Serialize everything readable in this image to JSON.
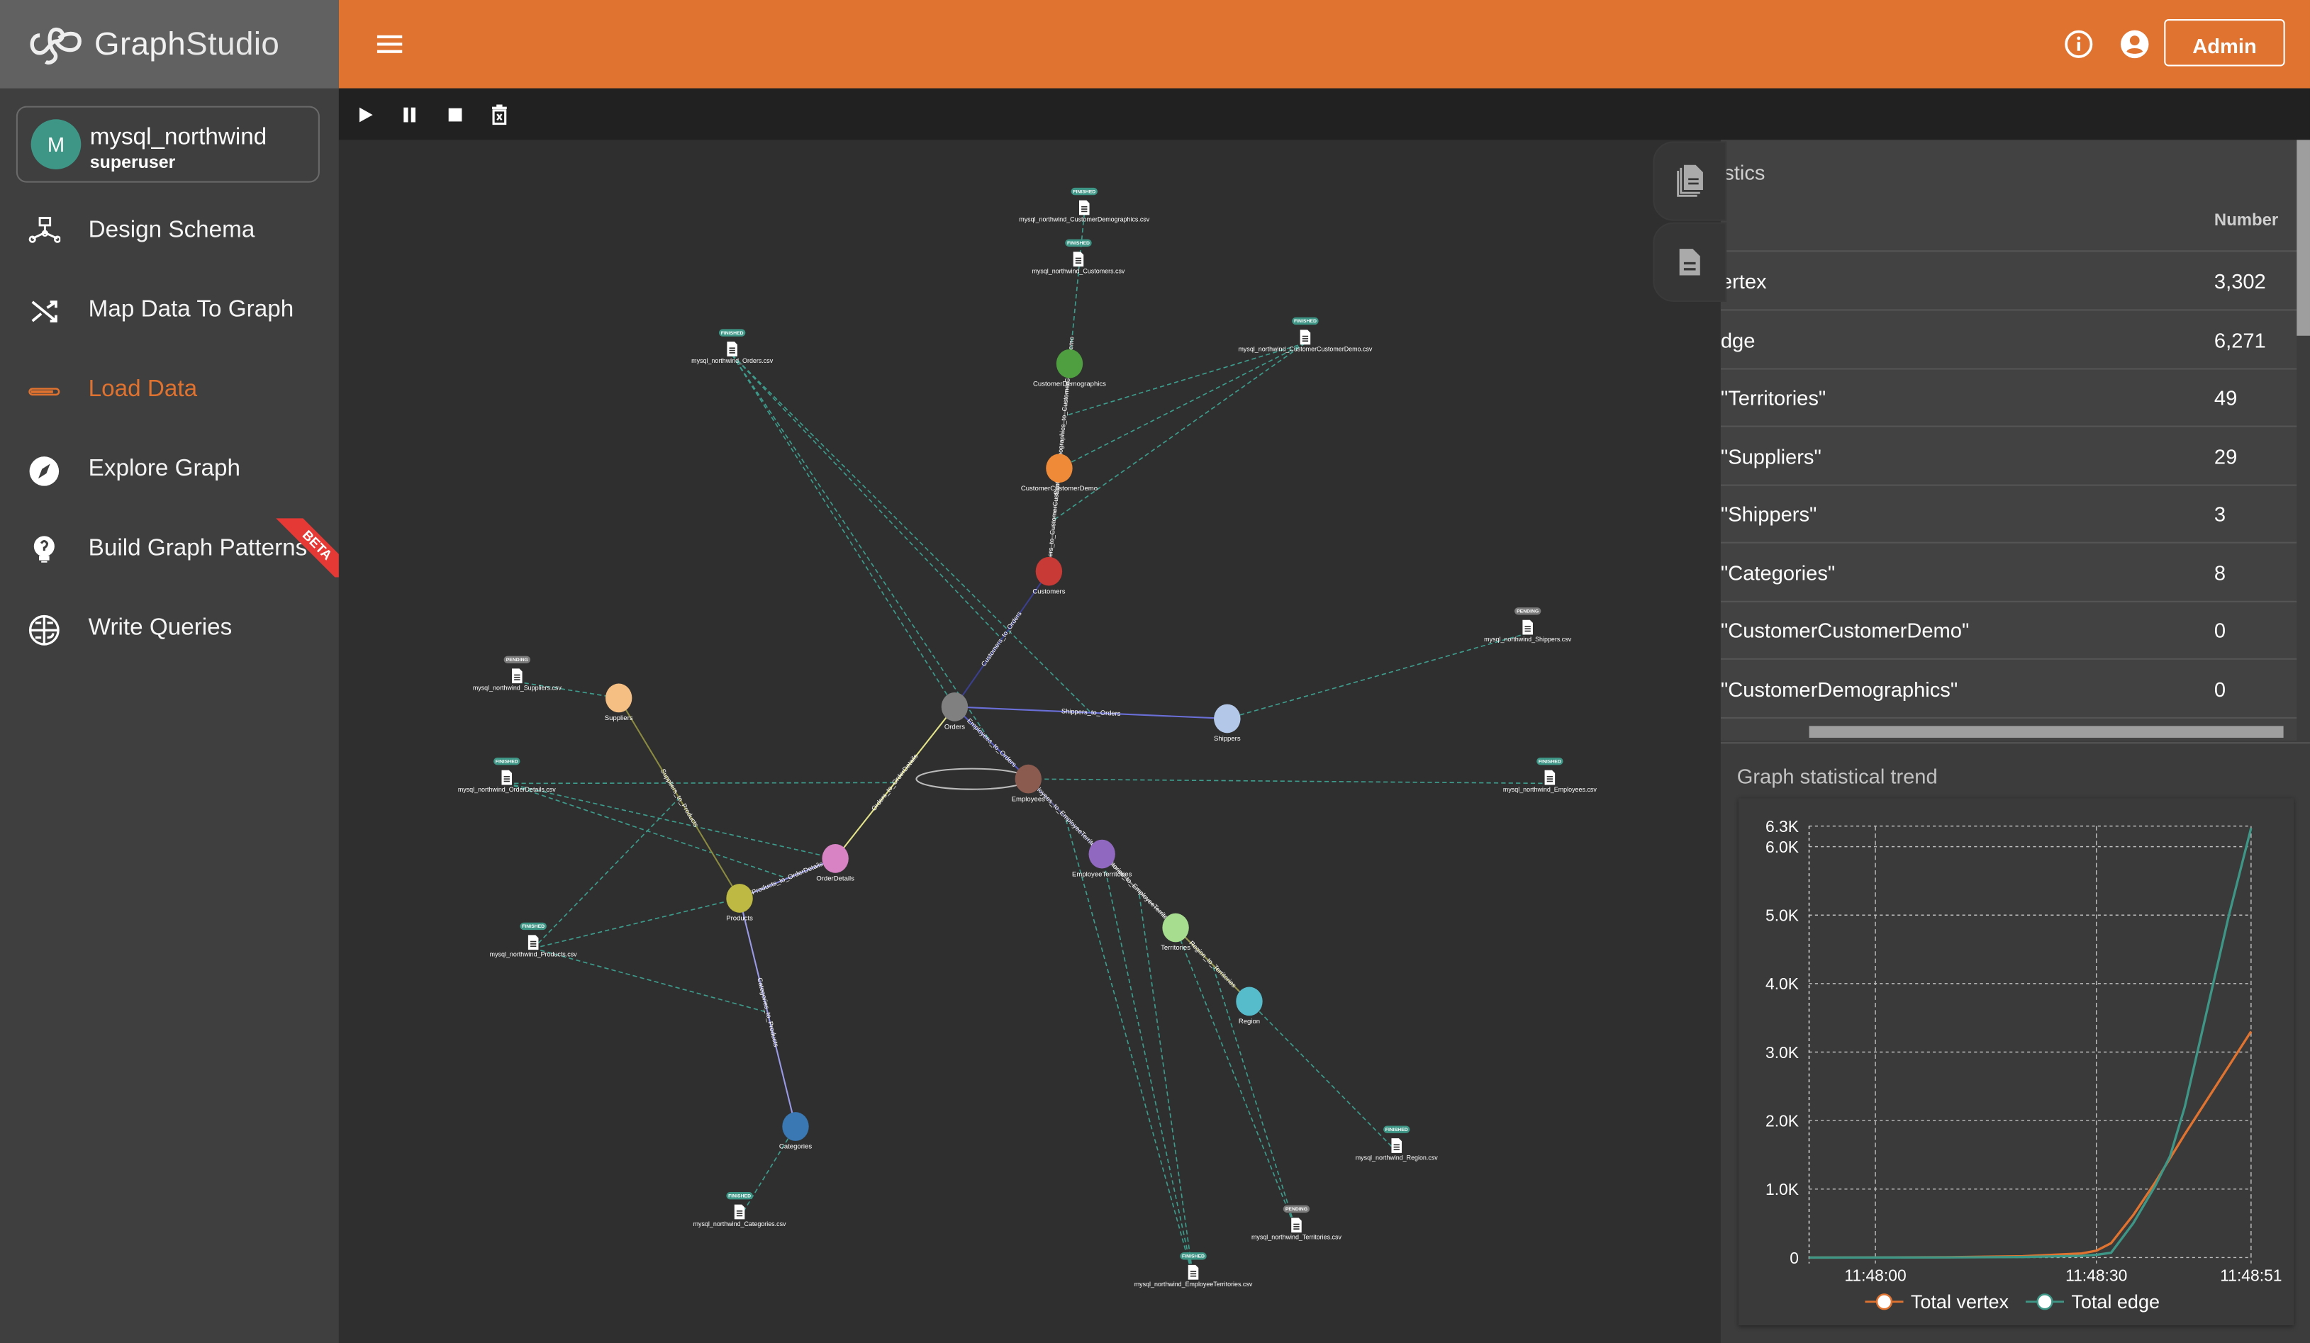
{
  "app": {
    "logo_text_bold": "Graph",
    "logo_text_light": "Studio"
  },
  "graph_card": {
    "avatar_letter": "M",
    "name": "mysql_northwind",
    "role": "superuser"
  },
  "sidebar": {
    "items": [
      {
        "label": "Design Schema",
        "icon": "schema-icon",
        "active": false
      },
      {
        "label": "Map Data To Graph",
        "icon": "shuffle-icon",
        "active": false
      },
      {
        "label": "Load Data",
        "icon": "progress-bar-icon",
        "active": true
      },
      {
        "label": "Explore Graph",
        "icon": "compass-icon",
        "active": false
      },
      {
        "label": "Build Graph Patterns",
        "icon": "lightbulb-icon",
        "active": false,
        "badge": "BETA"
      },
      {
        "label": "Write Queries",
        "icon": "query-globe-icon",
        "active": false
      }
    ]
  },
  "topbar": {
    "admin_label": "Admin",
    "menu_icon": "hamburger-icon",
    "info_icon": "info-icon",
    "user_icon": "account-circle-icon"
  },
  "toolbar": {
    "buttons": [
      "play-icon",
      "pause-icon",
      "stop-icon",
      "delete-icon"
    ]
  },
  "colors": {
    "accent": "#e07330",
    "finished": "#3d9686",
    "pending": "#7a7a7a",
    "mapping_line": "#3d9c8c",
    "vertex_series": "#e07330",
    "edge_series": "#3d9686"
  },
  "graph": {
    "vertices": [
      {
        "id": "CustomerDemographics",
        "color": "#4f9e3f"
      },
      {
        "id": "CustomerCustomerDemo",
        "color": "#ef8a38"
      },
      {
        "id": "Customers",
        "color": "#c73a35"
      },
      {
        "id": "Orders",
        "color": "#808080"
      },
      {
        "id": "Shippers",
        "color": "#b3c8e8"
      },
      {
        "id": "Employees",
        "color": "#8a5b4e"
      },
      {
        "id": "EmployeeTerritories",
        "color": "#9068c0"
      },
      {
        "id": "Territories",
        "color": "#a6dd8f"
      },
      {
        "id": "Region",
        "color": "#56bccc"
      },
      {
        "id": "Suppliers",
        "color": "#f5bf84"
      },
      {
        "id": "OrderDetails",
        "color": "#d783c4"
      },
      {
        "id": "Products",
        "color": "#bdb943"
      },
      {
        "id": "Categories",
        "color": "#3a78b3"
      }
    ],
    "edges": [
      {
        "label": "CustomerDemographics_to_CustomerCustomerDemo",
        "from": "CustomerDemographics",
        "to": "CustomerCustomerDemo",
        "color": "#6e6e6e"
      },
      {
        "label": "Customers_to_CustomerCustomerDemo",
        "from": "Customers",
        "to": "CustomerCustomerDemo",
        "color": "#6e6e6e"
      },
      {
        "label": "Customers_to_Orders",
        "from": "Customers",
        "to": "Orders",
        "color": "#3b3f8f"
      },
      {
        "label": "Shippers_to_Orders",
        "from": "Orders",
        "to": "Shippers",
        "color": "#6a6fd8"
      },
      {
        "label": "Employees_to_Orders",
        "from": "Orders",
        "to": "Employees",
        "color": "#5558c0"
      },
      {
        "label": "Orders_to_OrderDetails",
        "from": "OrderDetails",
        "to": "Orders",
        "color": "#e4e48a"
      },
      {
        "label": "Products_to_OrderDetails",
        "from": "Products",
        "to": "OrderDetails",
        "color": "#8c8cdc"
      },
      {
        "label": "Suppliers_to_Products",
        "from": "Suppliers",
        "to": "Products",
        "color": "#8a8a40"
      },
      {
        "label": "Categories_to_Products",
        "from": "Products",
        "to": "Categories",
        "color": "#9a9ae8"
      },
      {
        "label": "Employees_to_EmployeeTerritories",
        "from": "Employees",
        "to": "EmployeeTerritories",
        "color": "#5a5a8a"
      },
      {
        "label": "Territories_to_EmployeeTerritories",
        "from": "EmployeeTerritories",
        "to": "Territories",
        "color": "#888888"
      },
      {
        "label": "Region_to_Territories",
        "from": "Territories",
        "to": "Region",
        "color": "#9a9a55"
      }
    ],
    "self_loops": [
      "Employees"
    ],
    "files": [
      {
        "name": "mysql_northwind_CustomerDemographics.csv",
        "status": "FINISHED"
      },
      {
        "name": "mysql_northwind_Customers.csv",
        "status": "FINISHED"
      },
      {
        "name": "mysql_northwind_Orders.csv",
        "status": "FINISHED"
      },
      {
        "name": "mysql_northwind_CustomerCustomerDemo.csv",
        "status": "FINISHED"
      },
      {
        "name": "mysql_northwind_Shippers.csv",
        "status": "PENDING"
      },
      {
        "name": "mysql_northwind_Suppliers.csv",
        "status": "PENDING"
      },
      {
        "name": "mysql_northwind_OrderDetails.csv",
        "status": "FINISHED"
      },
      {
        "name": "mysql_northwind_Employees.csv",
        "status": "FINISHED"
      },
      {
        "name": "mysql_northwind_Products.csv",
        "status": "FINISHED"
      },
      {
        "name": "mysql_northwind_Region.csv",
        "status": "FINISHED"
      },
      {
        "name": "mysql_northwind_Territories.csv",
        "status": "PENDING"
      },
      {
        "name": "mysql_northwind_Categories.csv",
        "status": "FINISHED"
      },
      {
        "name": "mysql_northwind_EmployeeTerritories.csv",
        "status": "FINISHED"
      }
    ],
    "mappings": [
      {
        "file": "mysql_northwind_CustomerDemographics.csv",
        "target": "CustomerDemographics"
      },
      {
        "file": "mysql_northwind_CustomerCustomerDemo.csv",
        "target": "CustomerDemographics_to_CustomerCustomerDemo"
      },
      {
        "file": "mysql_northwind_CustomerCustomerDemo.csv",
        "target": "CustomerCustomerDemo"
      },
      {
        "file": "mysql_northwind_CustomerCustomerDemo.csv",
        "target": "Customers_to_CustomerCustomerDemo"
      },
      {
        "file": "mysql_northwind_Orders.csv",
        "target": "Orders"
      },
      {
        "file": "mysql_northwind_Orders.csv",
        "target": "Employees_to_Orders"
      },
      {
        "file": "mysql_northwind_Orders.csv",
        "target": "Customers_to_Orders"
      },
      {
        "file": "mysql_northwind_Orders.csv",
        "target": "Shippers_to_Orders"
      },
      {
        "file": "mysql_northwind_Shippers.csv",
        "target": "Shippers"
      },
      {
        "file": "mysql_northwind_Suppliers.csv",
        "target": "Suppliers"
      },
      {
        "file": "mysql_northwind_OrderDetails.csv",
        "target": "OrderDetails"
      },
      {
        "file": "mysql_northwind_OrderDetails.csv",
        "target": "Products_to_OrderDetails"
      },
      {
        "file": "mysql_northwind_OrderDetails.csv",
        "target": "Orders_to_OrderDetails"
      },
      {
        "file": "mysql_northwind_Employees.csv",
        "target": "Employees"
      },
      {
        "file": "mysql_northwind_Products.csv",
        "target": "Products"
      },
      {
        "file": "mysql_northwind_Products.csv",
        "target": "Suppliers_to_Products"
      },
      {
        "file": "mysql_northwind_Products.csv",
        "target": "Categories_to_Products"
      },
      {
        "file": "mysql_northwind_Categories.csv",
        "target": "Categories"
      },
      {
        "file": "mysql_northwind_Region.csv",
        "target": "Region"
      },
      {
        "file": "mysql_northwind_Territories.csv",
        "target": "Territories"
      },
      {
        "file": "mysql_northwind_Territories.csv",
        "target": "Region_to_Territories"
      },
      {
        "file": "mysql_northwind_EmployeeTerritories.csv",
        "target": "EmployeeTerritories"
      },
      {
        "file": "mysql_northwind_EmployeeTerritories.csv",
        "target": "Employees_to_EmployeeTerritories"
      },
      {
        "file": "mysql_northwind_EmployeeTerritories.csv",
        "target": "Territories_to_EmployeeTerritories"
      }
    ]
  },
  "statistics": {
    "title_visible": "istics",
    "column_number": "Number",
    "rows": [
      {
        "key": "ertex",
        "value": "3,302"
      },
      {
        "key": "dge",
        "value": "6,271"
      },
      {
        "key": "\"Territories\"",
        "value": "49"
      },
      {
        "key": "\"Suppliers\"",
        "value": "29"
      },
      {
        "key": "\"Shippers\"",
        "value": "3"
      },
      {
        "key": "\"Categories\"",
        "value": "8"
      },
      {
        "key": "\"CustomerCustomerDemo\"",
        "value": "0"
      },
      {
        "key": "\"CustomerDemographics\"",
        "value": "0"
      }
    ],
    "tab_icons": [
      "file-copy-icon",
      "description-icon"
    ]
  },
  "trend_title": "Graph statistical trend",
  "chart_data": {
    "type": "line",
    "title": "",
    "xlabel": "",
    "ylabel": "",
    "x_ticks": [
      "11:48:00",
      "11:48:30",
      "11:48:51"
    ],
    "y_ticks": [
      "0",
      "1.0K",
      "2.0K",
      "3.0K",
      "4.0K",
      "5.0K",
      "6.0K",
      "6.3K"
    ],
    "y_tick_values": [
      0,
      1000,
      2000,
      3000,
      4000,
      5000,
      6000,
      6300
    ],
    "xlim": [
      "11:47:51",
      "11:48:51"
    ],
    "ylim": [
      0,
      6300
    ],
    "grid": true,
    "legend": "bottom",
    "x": [
      "11:47:51",
      "11:48:10",
      "11:48:20",
      "11:48:28",
      "11:48:30",
      "11:48:32",
      "11:48:35",
      "11:48:38",
      "11:48:40",
      "11:48:42",
      "11:48:45",
      "11:48:48",
      "11:48:51"
    ],
    "series": [
      {
        "name": "Total vertex",
        "color": "#e07330",
        "values": [
          0,
          5,
          20,
          60,
          100,
          210,
          620,
          1100,
          1450,
          1800,
          2300,
          2800,
          3302
        ]
      },
      {
        "name": "Total edge",
        "color": "#3d9686",
        "values": [
          0,
          2,
          8,
          25,
          40,
          70,
          500,
          1050,
          1480,
          2200,
          3600,
          5000,
          6271
        ]
      }
    ]
  }
}
